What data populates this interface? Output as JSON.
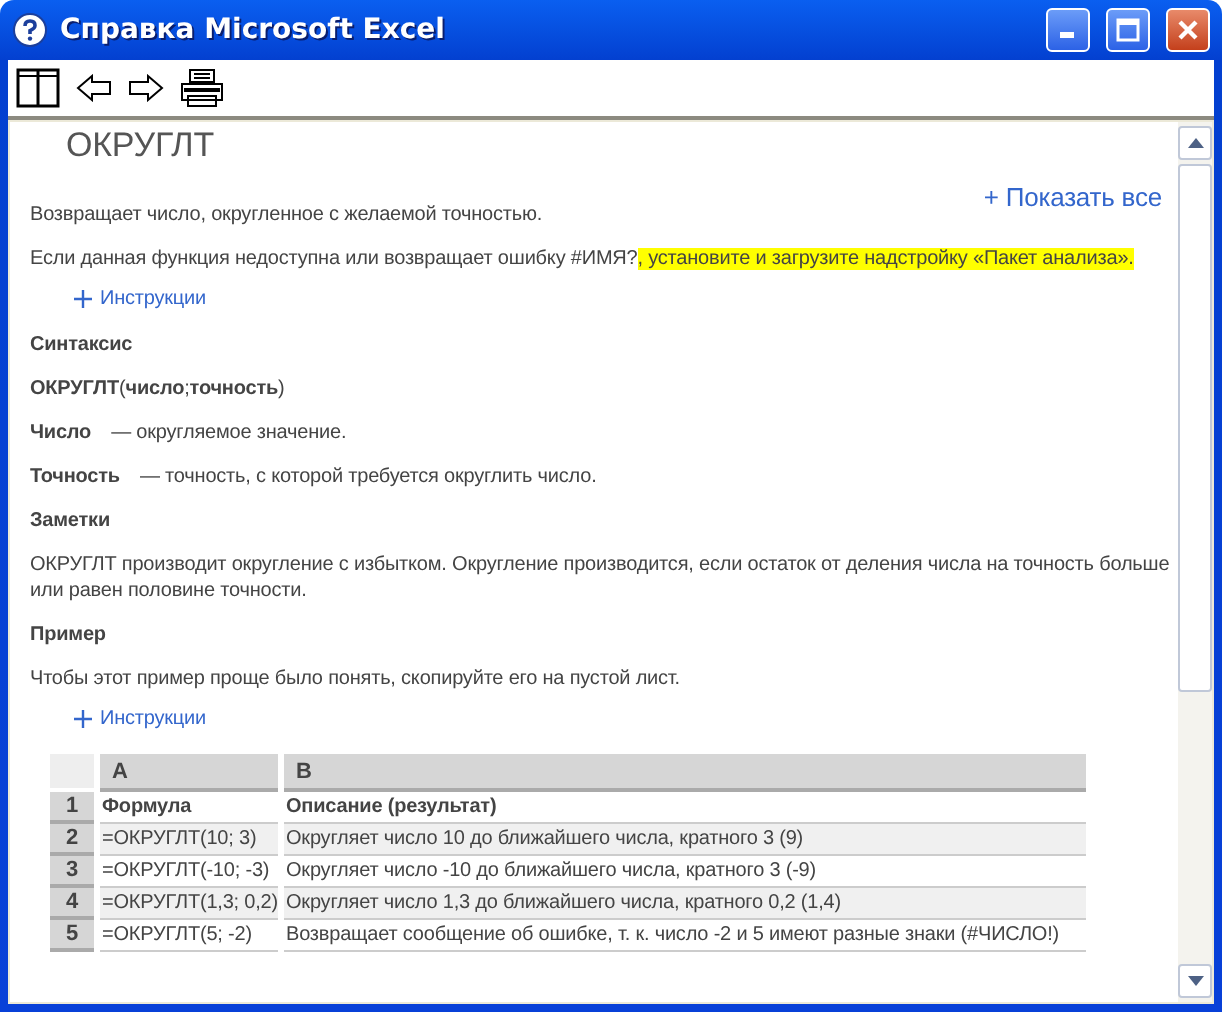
{
  "window": {
    "title": "Справка Microsoft Excel"
  },
  "toolbar": [
    {
      "kind": "pane"
    },
    {
      "kind": "back"
    },
    {
      "kind": "forward"
    },
    {
      "kind": "print"
    }
  ],
  "article": {
    "title": "ОКРУГЛТ",
    "show_all": "+ Показать все",
    "summary": "Возвращает число, округленное с желаемой точностью.",
    "notice": [
      {
        "text": "Если данная функция недоступна или возвращает ошибку #ИМЯ?",
        "highlighted": false
      },
      {
        "text": ", установите и загрузите надстройку «Пакет анализа».",
        "highlighted": true
      }
    ],
    "instructions_link": "Инструкции",
    "syntax_heading": "Синтаксис",
    "syntax": "**ОКРУГЛТ**(**число**;**точность**)",
    "arguments": [
      {
        "term": "Число",
        "description": "— округляемое значение."
      },
      {
        "term": "Точность",
        "description": "— точность, с которой требуется округлить число."
      }
    ],
    "notes_heading": "Заметки",
    "notes": "ОКРУГЛТ производит округление с избытком. Округление производится, если остаток от деления числа на точность больше или равен половине точности.",
    "example_heading": "Пример",
    "example_text": "Чтобы этот пример проще было понять, скопируйте его на пустой лист.",
    "example_link": "Инструкции"
  },
  "sheet": {
    "columns": [
      "A",
      "B"
    ],
    "rows": [
      {
        "number": "1",
        "cells": [
          "Формула",
          "Описание (результат)"
        ],
        "header": true
      },
      {
        "number": "2",
        "cells": [
          "=ОКРУГЛТ(10; 3)",
          "Округляет число 10 до ближайшего числа, кратного 3 (9)"
        ],
        "header": false
      },
      {
        "number": "3",
        "cells": [
          "=ОКРУГЛТ(-10; -3)",
          "Округляет число -10 до ближайшего числа, кратного 3 (-9)"
        ],
        "header": false
      },
      {
        "number": "4",
        "cells": [
          "=ОКРУГЛТ(1,3; 0,2)",
          "Округляет число 1,3 до ближайшего числа, кратного 0,2 (1,4)"
        ],
        "header": false
      },
      {
        "number": "5",
        "cells": [
          "=ОКРУГЛТ(5; -2)",
          "Возвращает сообщение об ошибке, т. к. число -2 и 5 имеют разные знаки (#ЧИСЛО!)"
        ],
        "header": false
      }
    ]
  }
}
